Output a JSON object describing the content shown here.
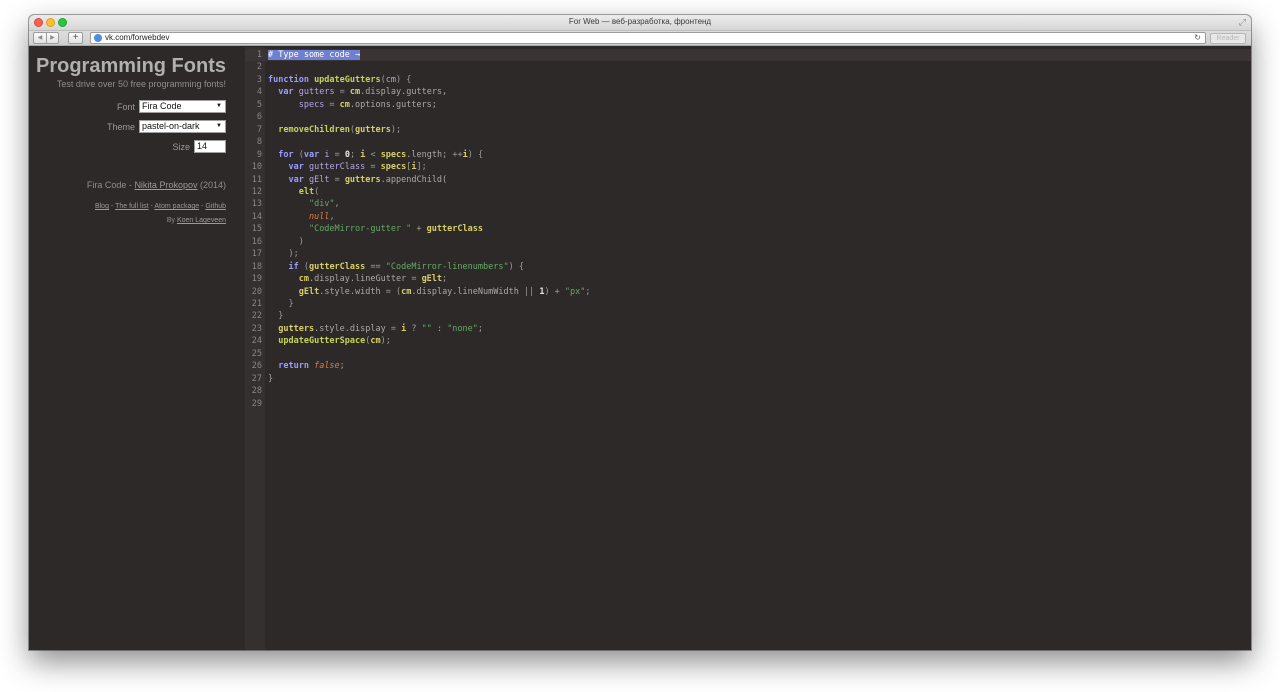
{
  "browser": {
    "window_title": "For Web — веб-разработка, фронтенд",
    "url": "vk.com/forwebdev",
    "reader_label": "Reader",
    "add_tab_label": "+"
  },
  "sidebar": {
    "title": "Programming Fonts",
    "subtitle": "Test drive over 50 free programming fonts!",
    "font_label": "Font",
    "font_value": "Fira Code",
    "theme_label": "Theme",
    "theme_value": "pastel-on-dark",
    "size_label": "Size",
    "size_value": "14",
    "credit_font": "Fira Code",
    "credit_sep": " - ",
    "credit_author": "Nikita Prokopov",
    "credit_year": " (2014)",
    "links": [
      "Blog",
      "The full list",
      "Atom package",
      "Github"
    ],
    "link_sep": " - ",
    "by_prefix": "By ",
    "by_author": "Koen Lageveen"
  },
  "editor": {
    "lines": [
      {
        "n": "1",
        "tokens": [
          [
            "hl",
            "# Type some code →"
          ]
        ]
      },
      {
        "n": "2",
        "tokens": []
      },
      {
        "n": "3",
        "tokens": [
          [
            "t-kw",
            "function "
          ],
          [
            "t-fn",
            "updateGutters"
          ],
          [
            "t-plain",
            "("
          ],
          [
            "t-def",
            "cm"
          ],
          [
            "t-plain",
            ") {"
          ]
        ]
      },
      {
        "n": "4",
        "tokens": [
          [
            "t-plain",
            "  "
          ],
          [
            "t-kw",
            "var "
          ],
          [
            "t-def",
            "gutters"
          ],
          [
            "t-plain",
            " = "
          ],
          [
            "t-yel",
            "cm"
          ],
          [
            "t-prop",
            ".display.gutters,"
          ]
        ]
      },
      {
        "n": "5",
        "tokens": [
          [
            "t-plain",
            "      "
          ],
          [
            "t-def",
            "specs"
          ],
          [
            "t-plain",
            " = "
          ],
          [
            "t-yel",
            "cm"
          ],
          [
            "t-prop",
            ".options.gutters;"
          ]
        ]
      },
      {
        "n": "6",
        "tokens": []
      },
      {
        "n": "7",
        "tokens": [
          [
            "t-plain",
            "  "
          ],
          [
            "t-fn",
            "removeChildren"
          ],
          [
            "t-plain",
            "("
          ],
          [
            "t-yel",
            "gutters"
          ],
          [
            "t-plain",
            ");"
          ]
        ]
      },
      {
        "n": "8",
        "tokens": []
      },
      {
        "n": "9",
        "tokens": [
          [
            "t-plain",
            "  "
          ],
          [
            "t-kw",
            "for "
          ],
          [
            "t-plain",
            "("
          ],
          [
            "t-kw",
            "var "
          ],
          [
            "t-def",
            "i"
          ],
          [
            "t-plain",
            " = "
          ],
          [
            "t-num",
            "0"
          ],
          [
            "t-plain",
            "; "
          ],
          [
            "t-yel",
            "i"
          ],
          [
            "t-plain",
            " < "
          ],
          [
            "t-yel",
            "specs"
          ],
          [
            "t-prop",
            ".length"
          ],
          [
            "t-plain",
            "; "
          ],
          [
            "t-plain",
            "++"
          ],
          [
            "t-yel",
            "i"
          ],
          [
            "t-plain",
            ") {"
          ]
        ]
      },
      {
        "n": "10",
        "tokens": [
          [
            "t-plain",
            "    "
          ],
          [
            "t-kw",
            "var "
          ],
          [
            "t-def",
            "gutterClass"
          ],
          [
            "t-plain",
            " = "
          ],
          [
            "t-yel",
            "specs"
          ],
          [
            "t-plain",
            "["
          ],
          [
            "t-yel",
            "i"
          ],
          [
            "t-plain",
            "];"
          ]
        ]
      },
      {
        "n": "11",
        "tokens": [
          [
            "t-plain",
            "    "
          ],
          [
            "t-kw",
            "var "
          ],
          [
            "t-def",
            "gElt"
          ],
          [
            "t-plain",
            " = "
          ],
          [
            "t-yel",
            "gutters"
          ],
          [
            "t-prop",
            ".appendChild("
          ]
        ]
      },
      {
        "n": "12",
        "tokens": [
          [
            "t-plain",
            "      "
          ],
          [
            "t-fn",
            "elt"
          ],
          [
            "t-plain",
            "("
          ]
        ]
      },
      {
        "n": "13",
        "tokens": [
          [
            "t-plain",
            "        "
          ],
          [
            "t-str",
            "\"div\""
          ],
          [
            "t-plain",
            ","
          ]
        ]
      },
      {
        "n": "14",
        "tokens": [
          [
            "t-plain",
            "        "
          ],
          [
            "t-atom",
            "null"
          ],
          [
            "t-plain",
            ","
          ]
        ]
      },
      {
        "n": "15",
        "tokens": [
          [
            "t-plain",
            "        "
          ],
          [
            "t-str",
            "\"CodeMirror-gutter \""
          ],
          [
            "t-plain",
            " + "
          ],
          [
            "t-yel",
            "gutterClass"
          ]
        ]
      },
      {
        "n": "16",
        "tokens": [
          [
            "t-plain",
            "      )"
          ]
        ]
      },
      {
        "n": "17",
        "tokens": [
          [
            "t-plain",
            "    );"
          ]
        ]
      },
      {
        "n": "18",
        "tokens": [
          [
            "t-plain",
            "    "
          ],
          [
            "t-kw",
            "if "
          ],
          [
            "t-plain",
            "("
          ],
          [
            "t-yel",
            "gutterClass"
          ],
          [
            "t-plain",
            " == "
          ],
          [
            "t-str",
            "\"CodeMirror-linenumbers\""
          ],
          [
            "t-plain",
            ") {"
          ]
        ]
      },
      {
        "n": "19",
        "tokens": [
          [
            "t-plain",
            "      "
          ],
          [
            "t-yel",
            "cm"
          ],
          [
            "t-prop",
            ".display.lineGutter"
          ],
          [
            "t-plain",
            " = "
          ],
          [
            "t-yel",
            "gElt"
          ],
          [
            "t-plain",
            ";"
          ]
        ]
      },
      {
        "n": "20",
        "tokens": [
          [
            "t-plain",
            "      "
          ],
          [
            "t-yel",
            "gElt"
          ],
          [
            "t-prop",
            ".style.width"
          ],
          [
            "t-plain",
            " = ("
          ],
          [
            "t-yel",
            "cm"
          ],
          [
            "t-prop",
            ".display.lineNumWidth"
          ],
          [
            "t-plain",
            " || "
          ],
          [
            "t-num",
            "1"
          ],
          [
            "t-plain",
            ") + "
          ],
          [
            "t-str",
            "\"px\""
          ],
          [
            "t-plain",
            ";"
          ]
        ]
      },
      {
        "n": "21",
        "tokens": [
          [
            "t-plain",
            "    }"
          ]
        ]
      },
      {
        "n": "22",
        "tokens": [
          [
            "t-plain",
            "  }"
          ]
        ]
      },
      {
        "n": "23",
        "tokens": [
          [
            "t-plain",
            "  "
          ],
          [
            "t-yel",
            "gutters"
          ],
          [
            "t-prop",
            ".style.display"
          ],
          [
            "t-plain",
            " = "
          ],
          [
            "t-yel",
            "i"
          ],
          [
            "t-plain",
            " ? "
          ],
          [
            "t-str",
            "\"\""
          ],
          [
            "t-plain",
            " : "
          ],
          [
            "t-str",
            "\"none\""
          ],
          [
            "t-plain",
            ";"
          ]
        ]
      },
      {
        "n": "24",
        "tokens": [
          [
            "t-plain",
            "  "
          ],
          [
            "t-fn",
            "updateGutterSpace"
          ],
          [
            "t-plain",
            "("
          ],
          [
            "t-yel",
            "cm"
          ],
          [
            "t-plain",
            ");"
          ]
        ]
      },
      {
        "n": "25",
        "tokens": []
      },
      {
        "n": "26",
        "tokens": [
          [
            "t-plain",
            "  "
          ],
          [
            "t-kw",
            "return "
          ],
          [
            "t-atom",
            "false"
          ],
          [
            "t-plain",
            ";"
          ]
        ]
      },
      {
        "n": "27",
        "tokens": [
          [
            "t-plain",
            "}"
          ]
        ]
      },
      {
        "n": "28",
        "tokens": []
      },
      {
        "n": "29",
        "tokens": []
      }
    ]
  }
}
